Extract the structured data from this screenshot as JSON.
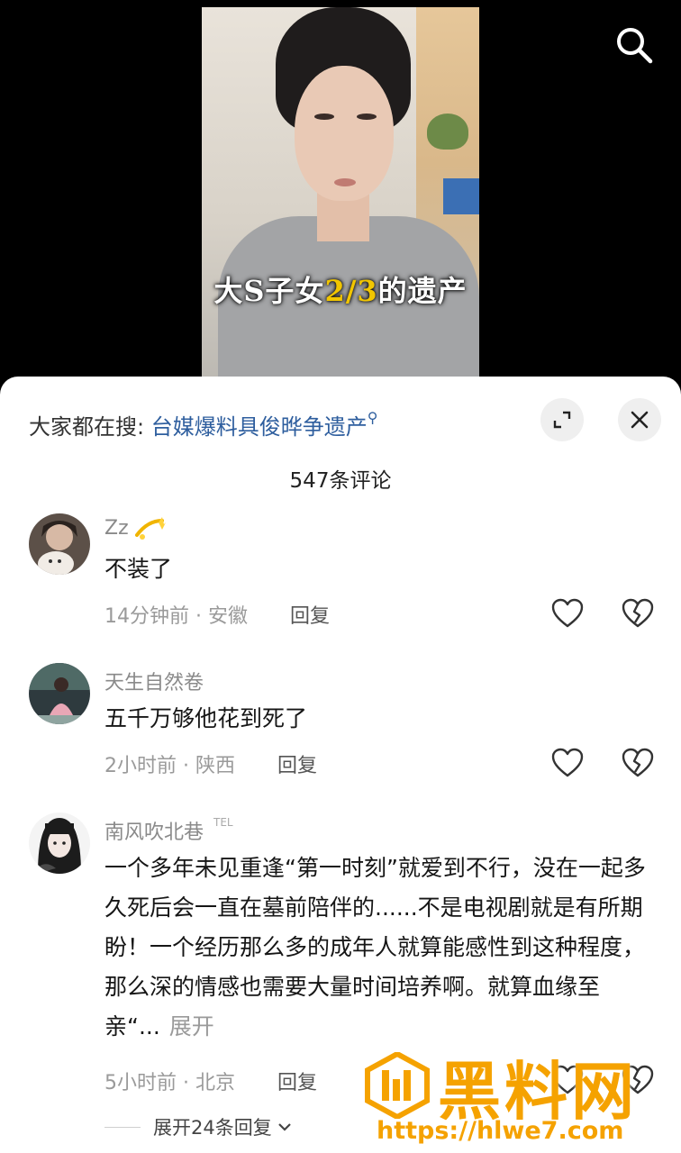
{
  "video": {
    "caption_parts": [
      "大S子女",
      "2/3",
      "的遗产"
    ]
  },
  "sheet": {
    "hot_search_prefix": "大家都在搜:",
    "hot_search_keyword": "台媒爆料具俊晔争遗产",
    "comment_count": "547条评论"
  },
  "comments": [
    {
      "name": "Zz",
      "text": "不装了",
      "time_location": "14分钟前 · 安徽",
      "reply_label": "回复"
    },
    {
      "name": "天生自然卷",
      "text": "五千万够他花到死了",
      "time_location": "2小时前 · 陕西",
      "reply_label": "回复"
    },
    {
      "name": "南风吹北巷",
      "badge": "TEL",
      "text": "一个多年未见重逢“第一时刻”就爱到不行，没在一起多久死后会一直在墓前陪伴的......不是电视剧就是有所期盼！一个经历那么多的成年人就算能感性到这种程度，那么深的情感也需要大量时间培养啊。就算血缘至亲“...",
      "expand_label": "展开",
      "time_location": "5小时前 · 北京",
      "reply_label": "回复",
      "more_replies": "展开24条回复"
    }
  ],
  "watermark": {
    "text": "黑料网",
    "url": "https://hlwe7.com"
  },
  "colors": {
    "accent_link": "#2e5e9e",
    "caption_highlight": "#f2c600",
    "watermark": "#f5a200"
  },
  "icons": [
    "search-icon",
    "expand-icon",
    "close-icon",
    "heart-icon",
    "broken-heart-icon",
    "chevron-down-icon",
    "sparkle-emoji"
  ]
}
